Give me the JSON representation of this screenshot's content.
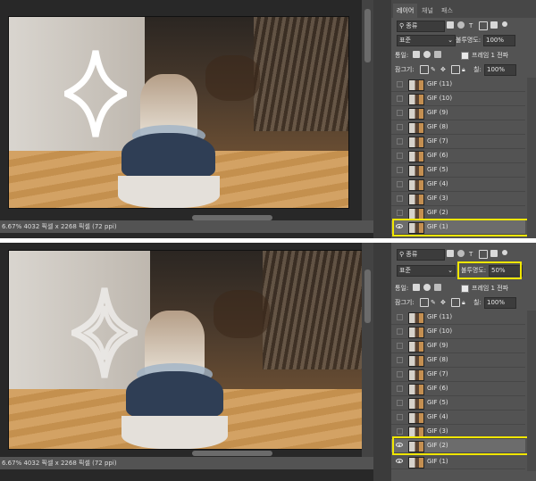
{
  "top": {
    "status_text": "6.67%    4032 픽셀 x 2268 픽셀 (72 ppi)",
    "tabs": [
      "레이어",
      "채널",
      "패스"
    ],
    "filter_label": "종류",
    "blend_mode": "표준",
    "opacity_label": "불투명도:",
    "opacity_value": "100%",
    "unify_label": "통일:",
    "propagate_label": "프레임 1 전파",
    "lock_label": "잠그기:",
    "fill_label": "칠:",
    "fill_value": "100%",
    "layers": [
      "GIF (11)",
      "GIF (10)",
      "GIF (9)",
      "GIF (8)",
      "GIF (7)",
      "GIF (6)",
      "GIF (5)",
      "GIF (4)",
      "GIF (3)",
      "GIF (2)",
      "GIF (1)"
    ],
    "visible_layers": [
      "GIF (1)"
    ],
    "selected_layer": "GIF (1)"
  },
  "bottom": {
    "status_text": "6.67%    4032 픽셀 x 2268 픽셀 (72 ppi)",
    "filter_label": "종류",
    "blend_mode": "표준",
    "opacity_label": "불투명도:",
    "opacity_value": "50%",
    "unify_label": "통일:",
    "propagate_label": "프레임 1 전파",
    "lock_label": "잠그기:",
    "fill_label": "칠:",
    "fill_value": "100%",
    "layers": [
      "GIF (11)",
      "GIF (10)",
      "GIF (9)",
      "GIF (8)",
      "GIF (7)",
      "GIF (6)",
      "GIF (5)",
      "GIF (4)",
      "GIF (3)",
      "GIF (2)",
      "GIF (1)"
    ],
    "visible_layers": [
      "GIF (2)",
      "GIF (1)"
    ],
    "selected_layer": "GIF (2)"
  },
  "colors": {
    "highlight": "#f0e600",
    "panel_bg": "#535353",
    "canvas_bg": "#282828"
  },
  "icons": [
    "search-icon",
    "pixel-layer-icon",
    "adjustment-icon",
    "type-icon",
    "shape-icon",
    "smart-object-icon",
    "eye-icon",
    "lock-icon",
    "brush-icon",
    "move-icon",
    "artboard-icon"
  ]
}
